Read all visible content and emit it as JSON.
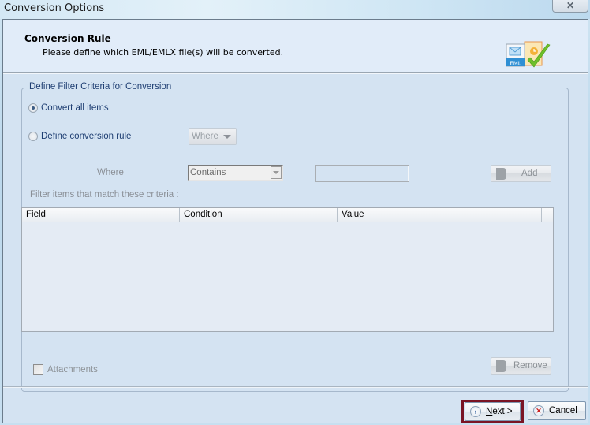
{
  "window": {
    "title": "Conversion Options",
    "close_icon": "close-x-icon"
  },
  "header": {
    "title": "Conversion Rule",
    "subtitle": "Please define which EML/EMLX file(s) will be converted.",
    "logo": {
      "icon": "eml-conversion-check-icon",
      "badge_text": "EML"
    }
  },
  "filter_group": {
    "legend": "Define Filter Criteria for Conversion",
    "options": [
      {
        "label": "Convert all items",
        "checked": true
      },
      {
        "label": "Define conversion rule",
        "checked": false
      }
    ],
    "where_dropdown": {
      "label": "Where",
      "enabled": false
    },
    "where_label": "Where",
    "condition_combo": {
      "value": "Contains",
      "enabled": false
    },
    "value_input": {
      "value": "",
      "enabled": false
    },
    "add_button": {
      "label": "Add",
      "enabled": false
    },
    "criteria_label": "Filter items that match these criteria :",
    "table": {
      "columns": [
        "Field",
        "Condition",
        "Value"
      ],
      "rows": []
    },
    "attachments": {
      "label": "Attachments",
      "checked": false,
      "enabled": false
    },
    "remove_button": {
      "label": "Remove",
      "enabled": false
    }
  },
  "footer": {
    "next_button": {
      "label": "Next >",
      "mnemonic": "N",
      "highlighted": true,
      "highlight_color": "#7a1424"
    },
    "cancel_button": {
      "label": "Cancel"
    }
  }
}
